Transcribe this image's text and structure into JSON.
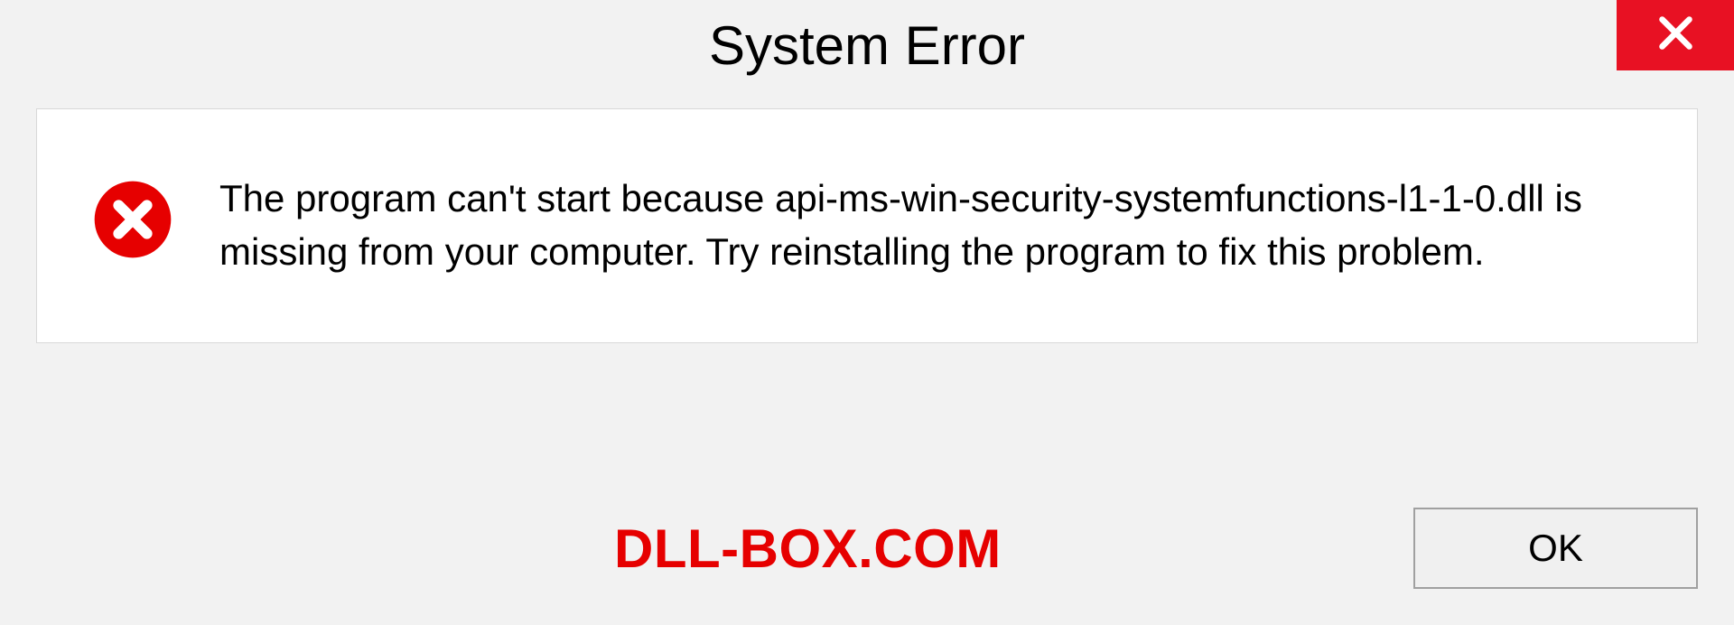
{
  "title": "System Error",
  "message": "The program can't start because api-ms-win-security-systemfunctions-l1-1-0.dll is missing from your computer. Try reinstalling the program to fix this problem.",
  "watermark": "DLL-BOX.COM",
  "buttons": {
    "ok": "OK"
  },
  "colors": {
    "close_bg": "#e81123",
    "error_red": "#e60000",
    "watermark_red": "#e60000"
  }
}
